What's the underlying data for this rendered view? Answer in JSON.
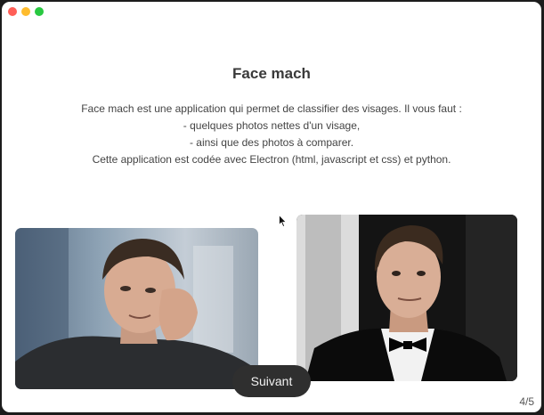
{
  "window": {
    "controls": [
      "close",
      "minimize",
      "zoom"
    ]
  },
  "content": {
    "title": "Face mach",
    "description": [
      "Face mach est une application qui permet de classifier des visages. Il vous faut :",
      "- quelques photos nettes d'un visage,",
      "- ainsi que des photos à comparer.",
      "Cette application est codée avec Electron (html, javascript et css) et python."
    ]
  },
  "images": {
    "left": "person-photo-icon",
    "right": "person-photo-icon"
  },
  "next_button": {
    "label": "Suivant"
  },
  "pagination": {
    "label": "4/5"
  },
  "colors": {
    "close": "#ff5f57",
    "minimize": "#febc2e",
    "zoom": "#28c840",
    "button_bg": "#2f2f2f"
  }
}
